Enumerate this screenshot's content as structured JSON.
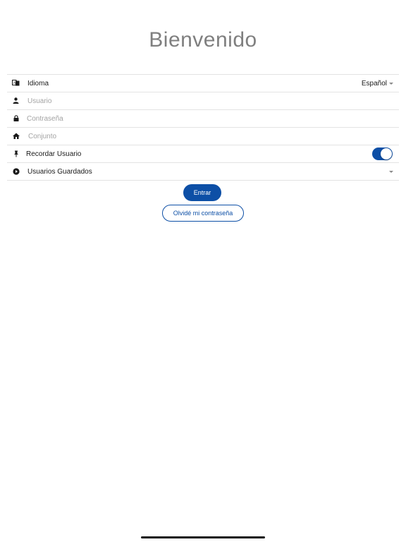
{
  "header": {
    "title": "Bienvenido"
  },
  "form": {
    "language": {
      "label": "Idioma",
      "value": "Español",
      "icon": "language-icon"
    },
    "username": {
      "placeholder": "Usuario",
      "value": "",
      "icon": "user-icon"
    },
    "password": {
      "placeholder": "Contraseña",
      "value": "",
      "icon": "lock-icon"
    },
    "complex": {
      "placeholder": "Conjunto",
      "value": "",
      "icon": "home-icon"
    },
    "remember": {
      "label": "Recordar Usuario",
      "checked": true,
      "icon": "pin-icon"
    },
    "saved_users": {
      "label": "Usuarios Guardados",
      "icon": "play-circle-icon"
    }
  },
  "actions": {
    "login_label": "Entrar",
    "forgot_label": "Olvidé mi contraseña"
  },
  "colors": {
    "accent": "#0d4fa6",
    "title": "#7f7f7f",
    "placeholder": "#a3a3a3",
    "divider": "#e3e3e3"
  }
}
